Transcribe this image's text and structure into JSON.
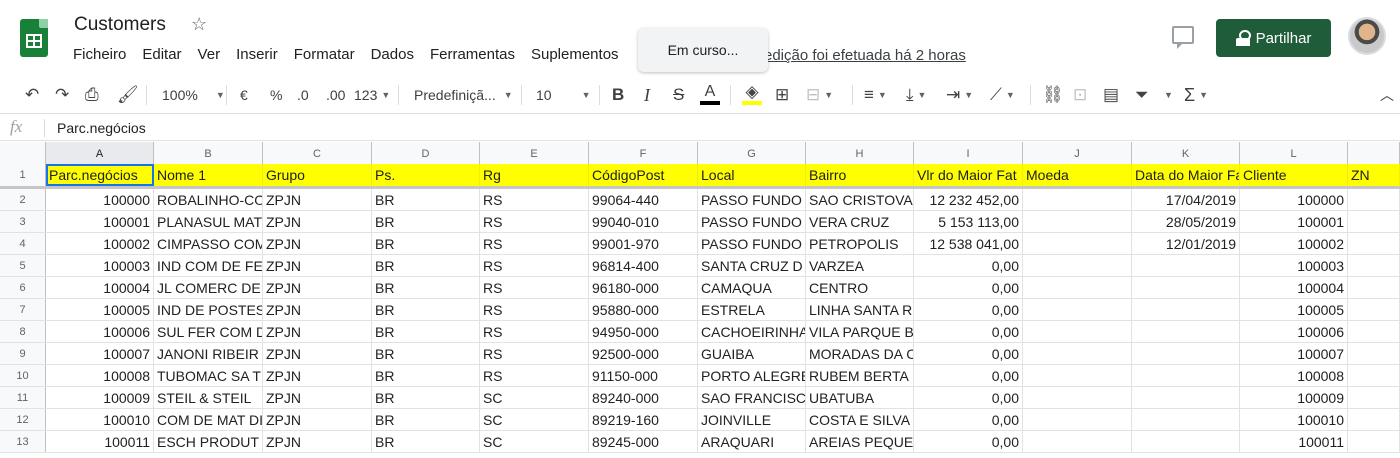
{
  "header": {
    "title": "Customers",
    "menu": [
      "Ficheiro",
      "Editar",
      "Ver",
      "Inserir",
      "Formatar",
      "Dados",
      "Ferramentas",
      "Suplementos"
    ],
    "last_edit": "edição foi efetuada há 2 horas",
    "toast": "Em curso...",
    "share_label": "Partilhar"
  },
  "toolbar": {
    "zoom": "100%",
    "currency": "€",
    "percent": "%",
    "dec_decrease": ".0",
    "dec_increase": ".00",
    "more_formats": "123",
    "font": "Predefiniçã...",
    "font_size": "10",
    "bold": "B",
    "italic": "I",
    "strike": "S",
    "text_color": "A",
    "function": "Σ"
  },
  "formula_bar": {
    "fx": "fx",
    "content": "Parc.negócios"
  },
  "grid": {
    "columns": [
      "A",
      "B",
      "C",
      "D",
      "E",
      "F",
      "G",
      "H",
      "I",
      "J",
      "K",
      "L"
    ],
    "selected_column": "A",
    "header_row": [
      "Parc.negócios",
      "Nome 1",
      "Grupo",
      "Ps.",
      "Rg",
      "CódigoPost",
      "Local",
      "Bairro",
      "Vlr do Maior Fat",
      "Moeda",
      "Data do Maior Fa",
      "Cliente",
      "ZN"
    ],
    "rows": [
      {
        "n": "2",
        "cells": [
          "100000",
          "ROBALINHO-CO",
          "ZPJN",
          "BR",
          "RS",
          "99064-440",
          "PASSO FUNDO",
          "SAO CRISTOVA",
          "12 232 452,00",
          "",
          "17/04/2019",
          "100000"
        ]
      },
      {
        "n": "3",
        "cells": [
          "100001",
          "PLANASUL MAT",
          "ZPJN",
          "BR",
          "RS",
          "99040-010",
          "PASSO FUNDO",
          "VERA CRUZ",
          "5 153 113,00",
          "",
          "28/05/2019",
          "100001"
        ]
      },
      {
        "n": "4",
        "cells": [
          "100002",
          "CIMPASSO COM",
          "ZPJN",
          "BR",
          "RS",
          "99001-970",
          "PASSO FUNDO",
          "PETROPOLIS",
          "12 538 041,00",
          "",
          "12/01/2019",
          "100002"
        ]
      },
      {
        "n": "5",
        "cells": [
          "100003",
          "IND COM DE FE",
          "ZPJN",
          "BR",
          "RS",
          "96814-400",
          "SANTA CRUZ D",
          "VARZEA",
          "0,00",
          "",
          "",
          "100003"
        ]
      },
      {
        "n": "6",
        "cells": [
          "100004",
          "JL COMERC DE",
          "ZPJN",
          "BR",
          "RS",
          "96180-000",
          "CAMAQUA",
          "CENTRO",
          "0,00",
          "",
          "",
          "100004"
        ]
      },
      {
        "n": "7",
        "cells": [
          "100005",
          "IND DE POSTES",
          "ZPJN",
          "BR",
          "RS",
          "95880-000",
          "ESTRELA",
          "LINHA SANTA R",
          "0,00",
          "",
          "",
          "100005"
        ]
      },
      {
        "n": "8",
        "cells": [
          "100006",
          "SUL FER COM D",
          "ZPJN",
          "BR",
          "RS",
          "94950-000",
          "CACHOEIRINHA",
          "VILA PARQUE B",
          "0,00",
          "",
          "",
          "100006"
        ]
      },
      {
        "n": "9",
        "cells": [
          "100007",
          "JANONI RIBEIR",
          "ZPJN",
          "BR",
          "RS",
          "92500-000",
          "GUAIBA",
          "MORADAS DA C",
          "0,00",
          "",
          "",
          "100007"
        ]
      },
      {
        "n": "10",
        "cells": [
          "100008",
          "TUBOMAC SA T",
          "ZPJN",
          "BR",
          "RS",
          "91150-000",
          "PORTO ALEGRE",
          "RUBEM BERTA",
          "0,00",
          "",
          "",
          "100008"
        ]
      },
      {
        "n": "11",
        "cells": [
          "100009",
          "STEIL & STEIL",
          "ZPJN",
          "BR",
          "SC",
          "89240-000",
          "SAO FRANCISC",
          "UBATUBA",
          "0,00",
          "",
          "",
          "100009"
        ]
      },
      {
        "n": "12",
        "cells": [
          "100010",
          "COM DE MAT DI",
          "ZPJN",
          "BR",
          "SC",
          "89219-160",
          "JOINVILLE",
          "COSTA E SILVA",
          "0,00",
          "",
          "",
          "100010"
        ]
      },
      {
        "n": "13",
        "cells": [
          "100011",
          "ESCH PRODUT",
          "ZPJN",
          "BR",
          "SC",
          "89245-000",
          "ARAQUARI",
          "AREIAS PEQUE",
          "0,00",
          "",
          "",
          "100011"
        ]
      }
    ]
  },
  "colors": {
    "header_fill": "#ffff00",
    "share_button": "#1e5c3a",
    "selection": "#1a73e8"
  }
}
